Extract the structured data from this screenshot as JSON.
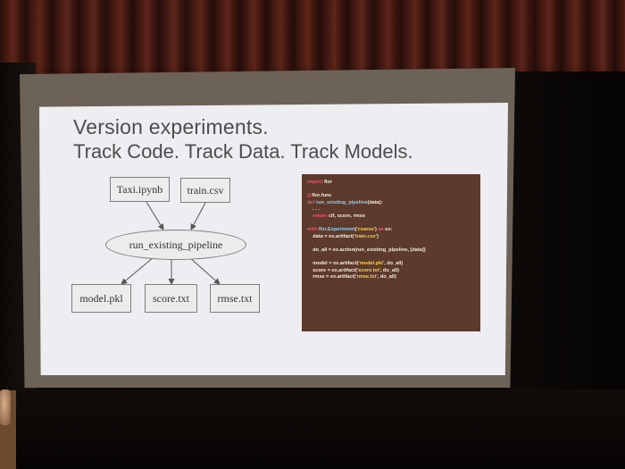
{
  "slide": {
    "title": "Version experiments.",
    "subtitle": "Track Code. Track Data. Track Models."
  },
  "diagram": {
    "inputs": [
      "Taxi.ipynb",
      "train.csv"
    ],
    "process": "run_existing_pipeline",
    "outputs": [
      "model.pkl",
      "score.txt",
      "rmse.txt"
    ]
  },
  "code": {
    "lines": [
      {
        "indent": "",
        "parts": [
          {
            "t": "import",
            "c": "kw"
          },
          {
            "t": " flor",
            "c": ""
          }
        ]
      },
      {
        "indent": "",
        "parts": []
      },
      {
        "indent": "",
        "parts": [
          {
            "t": "@",
            "c": "dec"
          },
          {
            "t": "flor.func",
            "c": ""
          }
        ]
      },
      {
        "indent": "",
        "parts": [
          {
            "t": "def",
            "c": "kw"
          },
          {
            "t": " run_existing_pipeline",
            "c": "fn"
          },
          {
            "t": "(data):",
            "c": ""
          }
        ]
      },
      {
        "indent": "    ",
        "parts": [
          {
            "t": ". . .",
            "c": ""
          }
        ]
      },
      {
        "indent": "    ",
        "parts": [
          {
            "t": "return",
            "c": "kw"
          },
          {
            "t": " clf, score, rmse",
            "c": ""
          }
        ]
      },
      {
        "indent": "",
        "parts": []
      },
      {
        "indent": "",
        "parts": [
          {
            "t": "with",
            "c": "kw"
          },
          {
            "t": " flor.Experiment",
            "c": "fn"
          },
          {
            "t": "(",
            "c": ""
          },
          {
            "t": "'coarse'",
            "c": "str"
          },
          {
            "t": ")",
            "c": ""
          },
          {
            "t": " as",
            "c": "kw"
          },
          {
            "t": " ex:",
            "c": ""
          }
        ]
      },
      {
        "indent": "    ",
        "parts": [
          {
            "t": "data = ex.artifact(",
            "c": ""
          },
          {
            "t": "'train.csv'",
            "c": "str"
          },
          {
            "t": ")",
            "c": ""
          }
        ]
      },
      {
        "indent": "",
        "parts": []
      },
      {
        "indent": "    ",
        "parts": [
          {
            "t": "do_all = ex.action(run_existing_pipeline, [data])",
            "c": ""
          }
        ]
      },
      {
        "indent": "",
        "parts": []
      },
      {
        "indent": "    ",
        "parts": [
          {
            "t": "model = ex.artifact(",
            "c": ""
          },
          {
            "t": "'model.pkl'",
            "c": "str"
          },
          {
            "t": ", do_all)",
            "c": ""
          }
        ]
      },
      {
        "indent": "    ",
        "parts": [
          {
            "t": "score = ex.artifact(",
            "c": ""
          },
          {
            "t": "'score.txt'",
            "c": "str"
          },
          {
            "t": ", do_all)",
            "c": ""
          }
        ]
      },
      {
        "indent": "    ",
        "parts": [
          {
            "t": "rmse = ex.artifact(",
            "c": ""
          },
          {
            "t": "'rmse.txt'",
            "c": "str"
          },
          {
            "t": ", do_all)",
            "c": ""
          }
        ]
      }
    ]
  },
  "colors": {
    "slide_background": "#eeedf1",
    "slide_text": "#4d4d4d",
    "code_background": "#5c3a2c",
    "keyword": "#f0556a",
    "string": "#ffd24a",
    "function": "#8fcff0"
  }
}
